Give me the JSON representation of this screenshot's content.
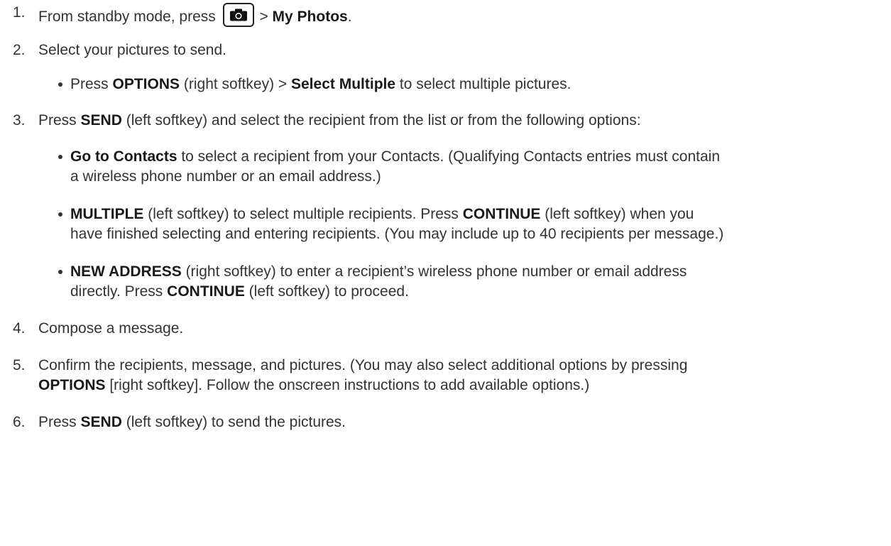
{
  "steps": [
    {
      "num": "1.",
      "pre": "From standby mode, press ",
      "post": " > ",
      "bold": "My Photos",
      "end": ".",
      "icon": "camera-icon"
    },
    {
      "num": "2.",
      "text": "Select your pictures to send."
    },
    {
      "num": "3.",
      "pre": "Press ",
      "bold": "SEND",
      "post": " (left softkey) and select the recipient from the list or from the following options:"
    },
    {
      "num": "4.",
      "text": "Compose a message."
    },
    {
      "num": "5.",
      "line1": "Confirm the recipients, message, and pictures. (You may also select additional options by pressing",
      "bold": "OPTIONS",
      "line2": " [right softkey]. Follow the onscreen instructions to add available options.)"
    },
    {
      "num": "6.",
      "pre": "Press ",
      "bold": "SEND",
      "post": " (left softkey) to send the pictures."
    }
  ],
  "bullets": {
    "b2": {
      "pre": "Press ",
      "bold1": "OPTIONS",
      "mid": " (right softkey) > ",
      "bold2": "Select Multiple",
      "post": " to select multiple pictures."
    },
    "b3a": {
      "bold": "Go to Contacts",
      "line1": " to select a recipient from your Contacts. (Qualifying Contacts entries must contain",
      "line2": "a wireless phone number or an email address.)"
    },
    "b3b": {
      "bold": "MULTIPLE",
      "line1a": " (left softkey) to select multiple recipients. Press ",
      "bold2": "CONTINUE",
      "line1b": " (left softkey) when you",
      "line2": "have finished selecting and entering recipients. (You may include up to 40 recipients per message.)"
    },
    "b3c": {
      "bold": "NEW ADDRESS",
      "line1": " (right softkey) to enter a recipient’s wireless phone number or email address",
      "line2pre": "directly. Press ",
      "bold2": "CONTINUE",
      "line2post": " (left softkey) to proceed."
    }
  }
}
